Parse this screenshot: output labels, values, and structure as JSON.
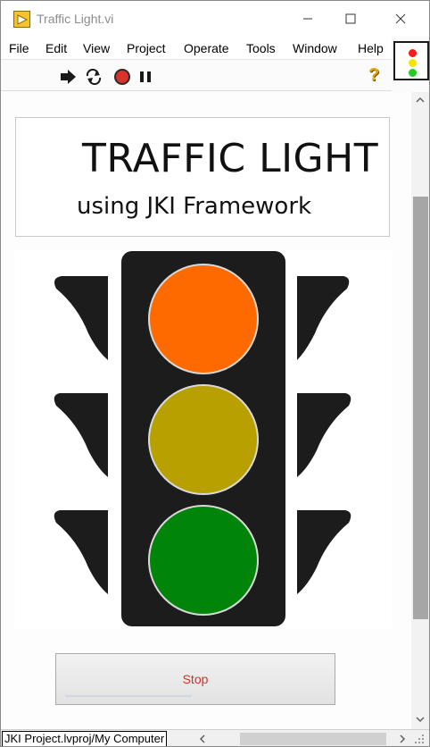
{
  "window": {
    "title": "Traffic Light.vi"
  },
  "menu": {
    "items": [
      "File",
      "Edit",
      "View",
      "Project",
      "Operate",
      "Tools",
      "Window",
      "Help"
    ]
  },
  "toolbar": {
    "run_icon": "run-arrow-icon",
    "run_continuous_icon": "run-continuously-icon",
    "abort_icon": "abort-stop-icon",
    "pause_icon": "pause-icon",
    "help_label": "?"
  },
  "panel": {
    "title": "TRAFFIC LIGHT",
    "subtitle": "using JKI Framework",
    "light": {
      "housing_color": "#1c1c1c",
      "red_lamp_color": "#ff6a00",
      "yellow_lamp_color": "#b8a000",
      "green_lamp_color": "#00850a",
      "lamp_ring_color": "#d9d9d9"
    },
    "stop_label": "Stop"
  },
  "status": {
    "context": "JKI Project.lvproj/My Computer"
  },
  "vi_icon": {
    "lamp_colors": [
      "#ff1a1a",
      "#f2e600",
      "#22cc22"
    ]
  }
}
